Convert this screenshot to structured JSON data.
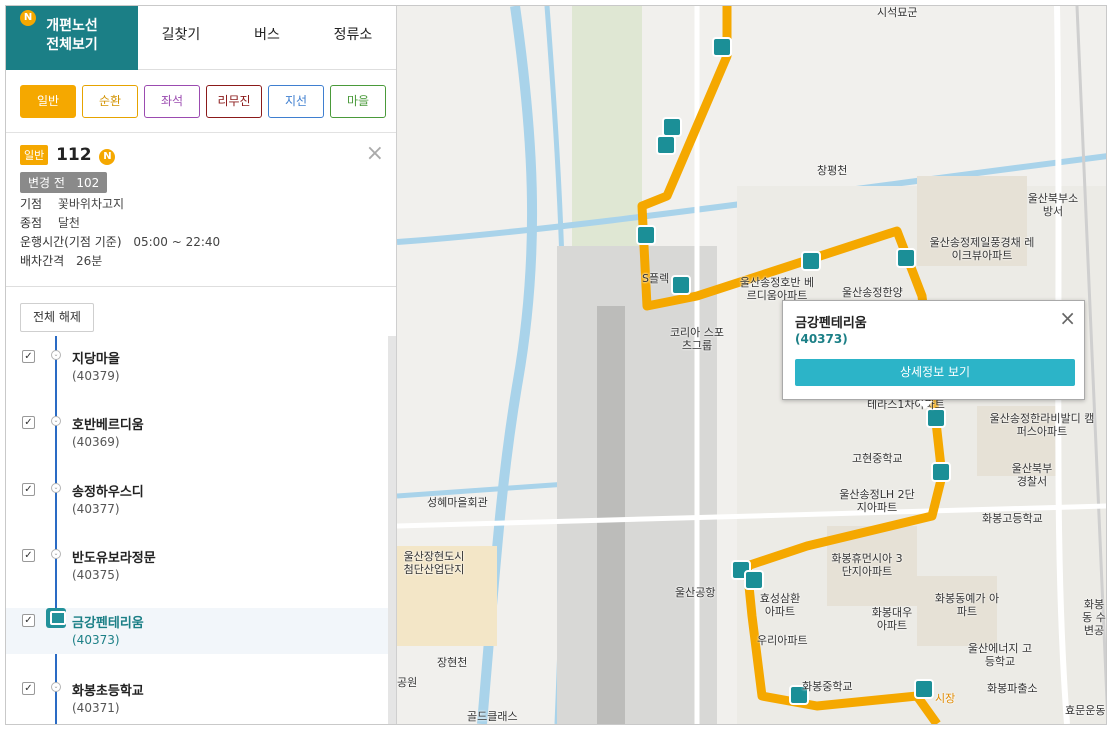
{
  "tabs": {
    "n_badge": "N",
    "main_line1": "개편노선",
    "main_line2": "전체보기",
    "directions": "길찾기",
    "bus": "버스",
    "stops": "정류소"
  },
  "filters": [
    {
      "label": "일반",
      "color": "#f5a800",
      "active": true
    },
    {
      "label": "순환",
      "color": "#e6a300"
    },
    {
      "label": "좌석",
      "color": "#9b4bb0"
    },
    {
      "label": "리무진",
      "color": "#8b1a1a"
    },
    {
      "label": "지선",
      "color": "#3f7fd0"
    },
    {
      "label": "마을",
      "color": "#4a9a3a"
    }
  ],
  "route": {
    "type": "일반",
    "number": "112",
    "n_badge": "N",
    "close": "×",
    "before_change": "변경 전",
    "before_number": "102",
    "origin_label": "기점",
    "origin": "꽃바위차고지",
    "terminal_label": "종점",
    "terminal": "달천",
    "hours_label": "운행시간(기점 기준)",
    "hours": "05:00 ~ 22:40",
    "interval_label": "배차간격",
    "interval": "26분"
  },
  "clear_all": "전체 해제",
  "stops": [
    {
      "name": "지당마을",
      "id": "(40379)"
    },
    {
      "name": "호반베르디움",
      "id": "(40369)"
    },
    {
      "name": "송정하우스디",
      "id": "(40377)"
    },
    {
      "name": "반도유보라정문",
      "id": "(40375)"
    },
    {
      "name": "금강펜테리움",
      "id": "(40373)",
      "active": true
    },
    {
      "name": "화봉초등학교",
      "id": "(40371)"
    }
  ],
  "popup": {
    "title": "금강펜테리움",
    "id": "(40373)",
    "button": "상세정보 보기",
    "close": "×"
  },
  "map_labels": [
    "시석묘군",
    "창평천",
    "울산북부소방서",
    "울산송정제일풍경채 레이크뷰아파트",
    "울산송정호반 베르디움아파트",
    "울산송정한양",
    "코리아 스포츠그룹",
    "테라스1차아파트",
    "울산송정한라비발디 캠퍼스아파트",
    "고현중학교",
    "울산북부 경찰서",
    "울산송정LH 2단지아파트",
    "화봉고등학교",
    "성혜마을회관",
    "울산장현도시 첨단산업단지",
    "화봉휴먼시아 3단지아파트",
    "울산공항",
    "효성삼환 아파트",
    "화봉동예가 아파트",
    "화봉대우 아파트",
    "우리아파트",
    "울산에너지 고등학교",
    "장현천",
    "공원",
    "화봉중학교",
    "화봉파출소",
    "골드클래스",
    "효문운동",
    "화봉동 수변공",
    "S플렉",
    "시장"
  ]
}
